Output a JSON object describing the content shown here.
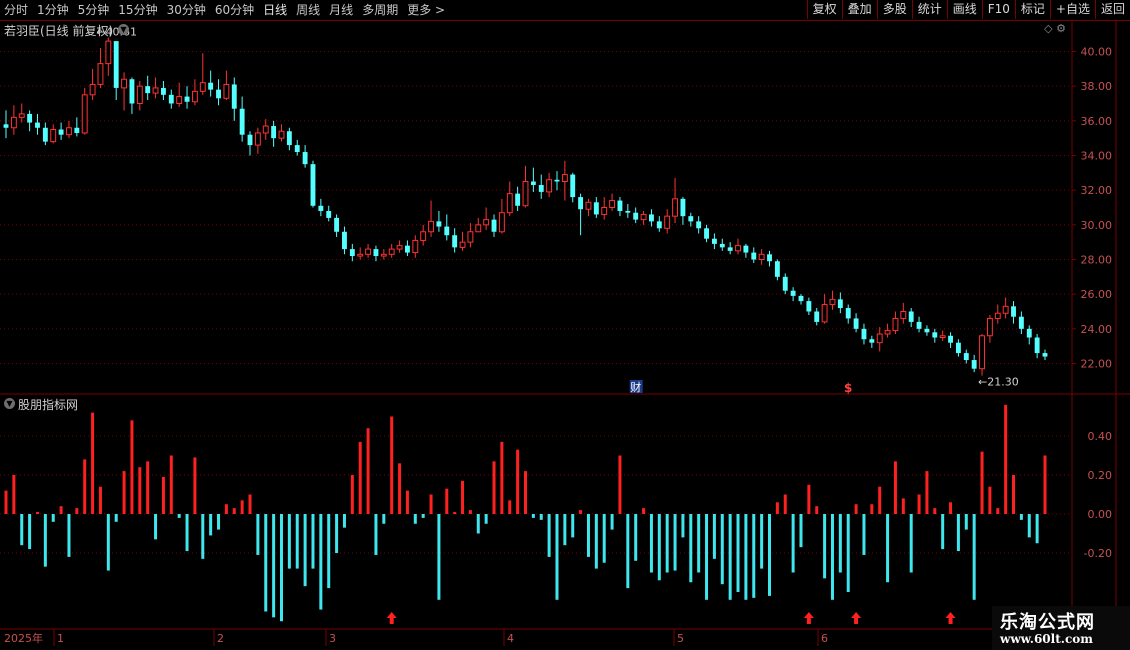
{
  "toolbar": {
    "periods": [
      "分时",
      "1分钟",
      "5分钟",
      "15分钟",
      "30分钟",
      "60分钟",
      "日线",
      "周线",
      "月线",
      "多周期",
      "更多 >"
    ],
    "active_period": "日线",
    "buttons": [
      "复权",
      "叠加",
      "多股",
      "统计",
      "画线",
      "F10",
      "标记",
      "+自选",
      "返回"
    ]
  },
  "stock": {
    "title": "若羽臣(日线 前复权)",
    "high_label": "40.61",
    "low_label": "21.30"
  },
  "indicator": {
    "title": "股朋指标网"
  },
  "markers": {
    "finance": "财",
    "dollar": "$"
  },
  "price_axis": [
    "40.00",
    "38.00",
    "36.00",
    "34.00",
    "32.00",
    "30.00",
    "28.00",
    "26.00",
    "24.00",
    "22.00"
  ],
  "ind_axis": [
    "0.40",
    "0.20",
    "0.00",
    "-0.20"
  ],
  "time_axis": {
    "year": "2025年",
    "months": [
      "1",
      "2",
      "3",
      "4",
      "5",
      "6"
    ]
  },
  "watermark": {
    "title": "乐淘公式网",
    "url": "www.60lt.com"
  },
  "colors": {
    "up": "#ff3232",
    "down": "#54ffff",
    "grid": "#7a0000",
    "axis_text": "#c85050"
  },
  "chart_data": {
    "type": "candlestick",
    "price_ylim": [
      21.0,
      41.5
    ],
    "indicator_ylim": [
      -0.55,
      0.6
    ],
    "candles": [
      [
        35.8,
        35.6,
        36.6,
        35.0
      ],
      [
        35.6,
        36.2,
        36.9,
        35.2
      ],
      [
        36.2,
        36.4,
        37.0,
        35.9
      ],
      [
        36.4,
        35.9,
        36.6,
        35.4
      ],
      [
        35.9,
        35.6,
        36.4,
        35.2
      ],
      [
        35.6,
        34.8,
        35.9,
        34.6
      ],
      [
        34.8,
        35.5,
        35.8,
        34.7
      ],
      [
        35.5,
        35.2,
        35.9,
        34.9
      ],
      [
        35.2,
        35.6,
        36.0,
        35.0
      ],
      [
        35.6,
        35.3,
        36.2,
        35.1
      ],
      [
        35.3,
        37.5,
        37.9,
        35.2
      ],
      [
        37.5,
        38.1,
        39.0,
        37.2
      ],
      [
        38.1,
        39.3,
        40.2,
        37.9
      ],
      [
        39.3,
        40.6,
        40.8,
        38.6
      ],
      [
        40.6,
        37.9,
        40.2,
        37.2
      ],
      [
        37.9,
        38.4,
        38.8,
        36.6
      ],
      [
        38.4,
        37.0,
        38.5,
        36.4
      ],
      [
        37.0,
        38.0,
        38.3,
        36.6
      ],
      [
        38.0,
        37.6,
        38.6,
        37.2
      ],
      [
        37.6,
        37.9,
        38.5,
        37.3
      ],
      [
        37.9,
        37.5,
        38.3,
        37.2
      ],
      [
        37.5,
        37.0,
        37.8,
        36.7
      ],
      [
        37.0,
        37.4,
        38.2,
        36.8
      ],
      [
        37.4,
        37.1,
        38.0,
        36.7
      ],
      [
        37.1,
        37.7,
        38.4,
        36.9
      ],
      [
        37.7,
        38.2,
        39.9,
        37.5
      ],
      [
        38.2,
        37.8,
        38.9,
        37.4
      ],
      [
        37.8,
        37.3,
        38.4,
        36.9
      ],
      [
        37.3,
        38.1,
        38.9,
        37.2
      ],
      [
        38.1,
        36.7,
        38.5,
        36.0
      ],
      [
        36.7,
        35.2,
        37.4,
        34.8
      ],
      [
        35.2,
        34.6,
        35.4,
        34.0
      ],
      [
        34.6,
        35.3,
        35.6,
        34.1
      ],
      [
        35.3,
        35.7,
        36.1,
        34.9
      ],
      [
        35.7,
        35.0,
        36.0,
        34.5
      ],
      [
        35.0,
        35.4,
        35.8,
        34.8
      ],
      [
        35.4,
        34.6,
        35.6,
        34.3
      ],
      [
        34.6,
        34.2,
        34.9,
        34.0
      ],
      [
        34.2,
        33.5,
        34.6,
        33.3
      ],
      [
        33.5,
        31.1,
        33.7,
        31.0
      ],
      [
        31.1,
        30.8,
        31.5,
        30.5
      ],
      [
        30.8,
        30.4,
        31.1,
        30.2
      ],
      [
        30.4,
        29.6,
        30.6,
        29.3
      ],
      [
        29.6,
        28.6,
        29.9,
        28.3
      ],
      [
        28.6,
        28.2,
        28.9,
        27.9
      ],
      [
        28.2,
        28.3,
        28.7,
        28.0
      ],
      [
        28.3,
        28.6,
        28.9,
        28.1
      ],
      [
        28.6,
        28.2,
        28.8,
        27.9
      ],
      [
        28.2,
        28.3,
        28.6,
        28.0
      ],
      [
        28.3,
        28.6,
        28.9,
        28.1
      ],
      [
        28.6,
        28.8,
        29.1,
        28.4
      ],
      [
        28.8,
        28.4,
        29.1,
        28.2
      ],
      [
        28.4,
        29.1,
        29.4,
        28.1
      ],
      [
        29.1,
        29.6,
        30.0,
        28.8
      ],
      [
        29.6,
        30.2,
        31.4,
        29.3
      ],
      [
        30.2,
        29.9,
        30.8,
        29.6
      ],
      [
        29.9,
        29.4,
        30.6,
        29.1
      ],
      [
        29.4,
        28.7,
        29.8,
        28.4
      ],
      [
        28.7,
        29.0,
        29.6,
        28.5
      ],
      [
        29.0,
        29.6,
        30.1,
        28.7
      ],
      [
        29.6,
        30.0,
        30.4,
        29.7
      ],
      [
        30.0,
        30.3,
        31.0,
        29.7
      ],
      [
        30.3,
        29.6,
        30.6,
        29.3
      ],
      [
        29.6,
        30.7,
        31.5,
        29.5
      ],
      [
        30.7,
        31.8,
        32.5,
        30.5
      ],
      [
        31.8,
        31.1,
        32.2,
        30.8
      ],
      [
        31.1,
        32.5,
        33.4,
        31.0
      ],
      [
        32.5,
        32.3,
        33.3,
        31.9
      ],
      [
        32.3,
        31.9,
        32.9,
        31.5
      ],
      [
        31.9,
        32.6,
        33.0,
        31.6
      ],
      [
        32.6,
        32.5,
        33.1,
        32.0
      ],
      [
        32.5,
        32.9,
        33.7,
        31.4
      ],
      [
        32.9,
        31.6,
        33.0,
        31.3
      ],
      [
        31.6,
        30.9,
        31.8,
        29.4
      ],
      [
        30.9,
        31.3,
        31.5,
        30.5
      ],
      [
        31.3,
        30.6,
        31.6,
        30.4
      ],
      [
        30.6,
        31.0,
        31.6,
        30.3
      ],
      [
        31.0,
        31.4,
        31.8,
        30.8
      ],
      [
        31.4,
        30.8,
        31.6,
        30.5
      ],
      [
        30.8,
        30.7,
        31.2,
        30.4
      ],
      [
        30.7,
        30.3,
        31.0,
        30.1
      ],
      [
        30.3,
        30.6,
        30.8,
        30.0
      ],
      [
        30.6,
        30.2,
        30.9,
        29.9
      ],
      [
        30.2,
        29.8,
        30.5,
        29.6
      ],
      [
        29.8,
        30.5,
        30.9,
        29.5
      ],
      [
        30.5,
        31.5,
        32.7,
        30.1
      ],
      [
        31.5,
        30.5,
        31.6,
        30.0
      ],
      [
        30.5,
        30.2,
        30.7,
        29.9
      ],
      [
        30.2,
        29.8,
        30.5,
        29.5
      ],
      [
        29.8,
        29.2,
        30.0,
        29.0
      ],
      [
        29.2,
        28.9,
        29.5,
        28.6
      ],
      [
        28.9,
        28.7,
        29.2,
        28.5
      ],
      [
        28.7,
        28.5,
        29.0,
        28.3
      ],
      [
        28.5,
        28.8,
        29.2,
        28.3
      ],
      [
        28.8,
        28.4,
        28.9,
        28.1
      ],
      [
        28.4,
        28.0,
        28.7,
        27.8
      ],
      [
        28.0,
        28.3,
        28.6,
        27.7
      ],
      [
        28.3,
        27.9,
        28.5,
        27.6
      ],
      [
        27.9,
        27.0,
        28.0,
        26.8
      ],
      [
        27.0,
        26.2,
        27.2,
        26.0
      ],
      [
        26.2,
        25.9,
        26.4,
        25.6
      ],
      [
        25.9,
        25.6,
        26.0,
        25.4
      ],
      [
        25.6,
        25.0,
        25.8,
        24.8
      ],
      [
        25.0,
        24.4,
        25.2,
        24.2
      ],
      [
        24.4,
        25.4,
        26.0,
        24.3
      ],
      [
        25.4,
        25.7,
        26.2,
        25.1
      ],
      [
        25.7,
        25.2,
        26.1,
        24.9
      ],
      [
        25.2,
        24.6,
        25.4,
        24.3
      ],
      [
        24.6,
        24.0,
        24.9,
        23.8
      ],
      [
        24.0,
        23.4,
        24.3,
        23.1
      ],
      [
        23.4,
        23.2,
        23.6,
        22.9
      ],
      [
        23.2,
        23.7,
        24.1,
        22.7
      ],
      [
        23.7,
        23.9,
        24.3,
        23.5
      ],
      [
        23.9,
        24.6,
        25.0,
        23.7
      ],
      [
        24.6,
        25.0,
        25.5,
        24.3
      ],
      [
        25.0,
        24.4,
        25.2,
        24.1
      ],
      [
        24.4,
        24.0,
        24.7,
        23.8
      ],
      [
        24.0,
        23.8,
        24.2,
        23.6
      ],
      [
        23.8,
        23.5,
        24.0,
        23.2
      ],
      [
        23.5,
        23.6,
        23.9,
        23.3
      ],
      [
        23.6,
        23.2,
        23.8,
        22.9
      ],
      [
        23.2,
        22.6,
        23.4,
        22.4
      ],
      [
        22.6,
        22.2,
        22.8,
        22.0
      ],
      [
        22.2,
        21.7,
        22.5,
        21.5
      ],
      [
        21.7,
        23.6,
        23.7,
        21.3
      ],
      [
        23.6,
        24.6,
        24.8,
        23.2
      ],
      [
        24.6,
        24.9,
        25.4,
        24.3
      ],
      [
        24.9,
        25.3,
        25.8,
        24.6
      ],
      [
        25.3,
        24.7,
        25.6,
        24.3
      ],
      [
        24.7,
        24.0,
        25.0,
        23.7
      ],
      [
        24.0,
        23.5,
        24.2,
        23.1
      ],
      [
        23.5,
        22.6,
        23.7,
        22.3
      ],
      [
        22.6,
        22.4,
        22.8,
        22.2
      ]
    ],
    "indicator": [
      0.12,
      0.2,
      -0.16,
      -0.18,
      0.01,
      -0.27,
      -0.04,
      0.04,
      -0.22,
      0.03,
      0.28,
      0.52,
      0.14,
      -0.29,
      -0.04,
      0.22,
      0.48,
      0.24,
      0.27,
      -0.13,
      0.19,
      0.3,
      -0.02,
      -0.19,
      0.29,
      -0.23,
      -0.11,
      -0.08,
      0.05,
      0.03,
      0.07,
      0.1,
      -0.21,
      -0.5,
      -0.53,
      -0.55,
      -0.28,
      -0.28,
      -0.37,
      -0.28,
      -0.49,
      -0.38,
      -0.2,
      -0.07,
      0.2,
      0.37,
      0.44,
      -0.21,
      -0.05,
      0.5,
      0.26,
      0.12,
      -0.05,
      -0.02,
      0.1,
      -0.44,
      0.13,
      0.01,
      0.17,
      0.02,
      -0.1,
      -0.05,
      0.27,
      0.37,
      0.07,
      0.33,
      0.22,
      -0.02,
      -0.03,
      -0.22,
      -0.44,
      -0.16,
      -0.12,
      0.02,
      -0.22,
      -0.28,
      -0.25,
      -0.08,
      0.3,
      -0.38,
      -0.24,
      0.03,
      -0.3,
      -0.34,
      -0.3,
      -0.29,
      -0.12,
      -0.35,
      -0.3,
      -0.44,
      -0.23,
      -0.36,
      -0.44,
      -0.4,
      -0.44,
      -0.43,
      -0.28,
      -0.42,
      0.06,
      0.1,
      -0.3,
      -0.17,
      0.15,
      0.04,
      -0.33,
      -0.44,
      -0.3,
      -0.4,
      0.05,
      -0.21,
      0.05,
      0.14,
      -0.35,
      0.27,
      0.08,
      -0.3,
      0.1,
      0.22,
      0.03,
      -0.18,
      0.06,
      -0.19,
      -0.08,
      -0.44,
      0.32,
      0.14,
      0.03,
      0.56,
      0.2,
      -0.03,
      -0.12,
      -0.15,
      0.3
    ],
    "annotations": {
      "high": {
        "index": 13,
        "value": "40.61"
      },
      "low": {
        "index": 124,
        "value": "21.30"
      }
    },
    "signal_arrow_indices": [
      49,
      102,
      108,
      120
    ],
    "finance_marker_index": 80,
    "dollar_marker_index": 107
  }
}
